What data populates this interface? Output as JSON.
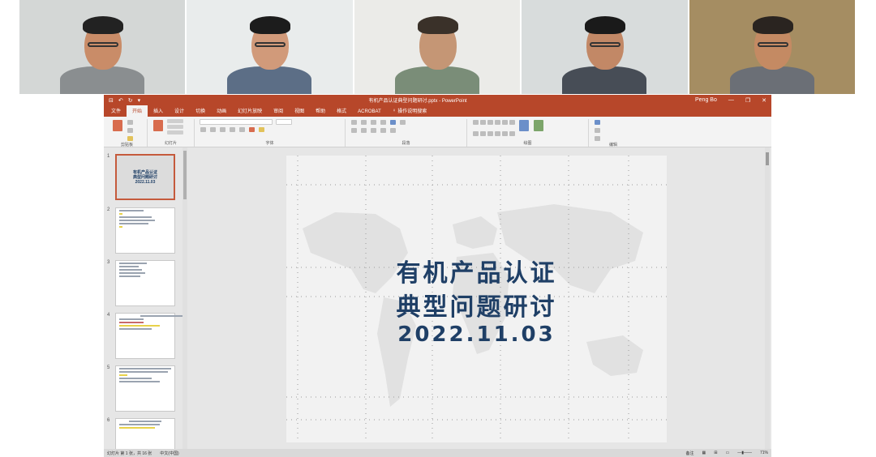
{
  "participants": [
    {
      "bg": "#d4d7d6",
      "skin": "#c98c68",
      "hair": "#222222",
      "shirt": "#8a8e90",
      "glasses": true
    },
    {
      "bg": "#e9ecec",
      "skin": "#d19a7a",
      "hair": "#1c1c1c",
      "shirt": "#5c6e86",
      "glasses": true
    },
    {
      "bg": "#ebebe8",
      "skin": "#c59675",
      "hair": "#3a3129",
      "shirt": "#7a8d78",
      "glasses": false
    },
    {
      "bg": "#d8dcdc",
      "skin": "#c28866",
      "hair": "#1a1a1a",
      "shirt": "#474d56",
      "glasses": true
    },
    {
      "bg": "#a58d62",
      "skin": "#c48a63",
      "hair": "#2a2420",
      "shirt": "#6b6f76",
      "glasses": true
    }
  ],
  "window": {
    "title": "有机产品认证典型问题研讨.pptx - PowerPoint",
    "user": "Peng Bo",
    "quick_access": [
      "⊟",
      "↶",
      "↻",
      "▾"
    ],
    "controls": [
      "—",
      "❐",
      "✕"
    ]
  },
  "tabs": [
    "文件",
    "开始",
    "插入",
    "设计",
    "切换",
    "动画",
    "幻灯片放映",
    "审阅",
    "视图",
    "帮助",
    "格式",
    "ACROBAT",
    "操作说明搜索"
  ],
  "active_tab_index": 1,
  "ribbon_groups": [
    "剪贴板",
    "幻灯片",
    "字体",
    "段落",
    "绘图",
    "编辑"
  ],
  "thumbnails": {
    "numbers": [
      "1",
      "2",
      "3",
      "4",
      "5",
      "6"
    ],
    "slide1_lines": [
      "有机产品认证",
      "典型问题研讨",
      "2022.11.03"
    ]
  },
  "slide": {
    "line1": "有机产品认证",
    "line2": "典型问题研讨",
    "line3": "2022.11.03",
    "title_color": "#1f3f66"
  },
  "status": {
    "slide_count": "幻灯片 第 1 张，共 16 张",
    "language": "中文(中国)",
    "notes": "备注",
    "zoom": "71%"
  }
}
